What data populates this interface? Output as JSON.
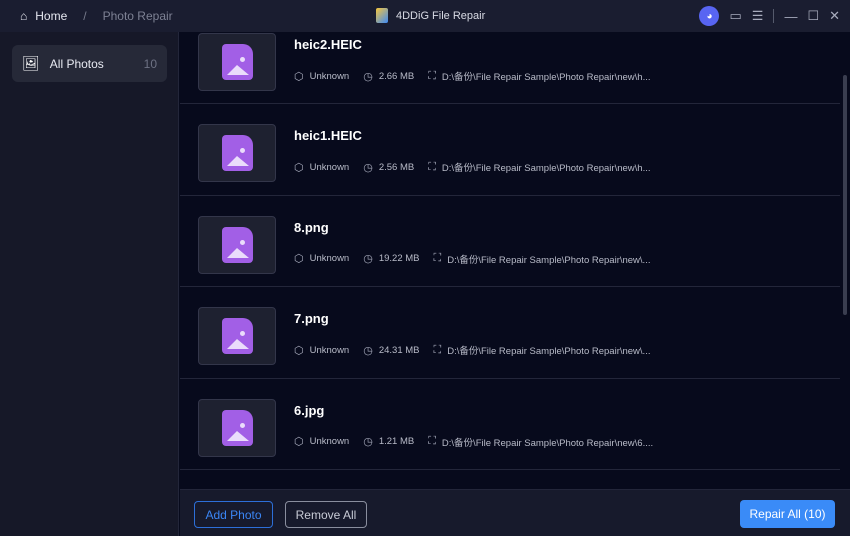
{
  "titlebar": {
    "home": "Home",
    "separator": "/",
    "current": "Photo Repair",
    "app_title": "4DDiG File Repair"
  },
  "sidebar": {
    "items": [
      {
        "label": "All Photos",
        "count": "10"
      }
    ]
  },
  "files": [
    {
      "name": "heic2.HEIC",
      "type": "Unknown",
      "size": "2.66 MB",
      "path": "D:\\备份\\File Repair Sample\\Photo Repair\\new\\h..."
    },
    {
      "name": "heic1.HEIC",
      "type": "Unknown",
      "size": "2.56 MB",
      "path": "D:\\备份\\File Repair Sample\\Photo Repair\\new\\h..."
    },
    {
      "name": "8.png",
      "type": "Unknown",
      "size": "19.22 MB",
      "path": "D:\\备份\\File Repair Sample\\Photo Repair\\new\\..."
    },
    {
      "name": "7.png",
      "type": "Unknown",
      "size": "24.31 MB",
      "path": "D:\\备份\\File Repair Sample\\Photo Repair\\new\\..."
    },
    {
      "name": "6.jpg",
      "type": "Unknown",
      "size": "1.21 MB",
      "path": "D:\\备份\\File Repair Sample\\Photo Repair\\new\\6...."
    }
  ],
  "footer": {
    "add": "Add Photo",
    "remove": "Remove All",
    "repair": "Repair All (10)"
  },
  "colors": {
    "accent": "#3a8bf7",
    "file_icon": "#a25fe6"
  }
}
